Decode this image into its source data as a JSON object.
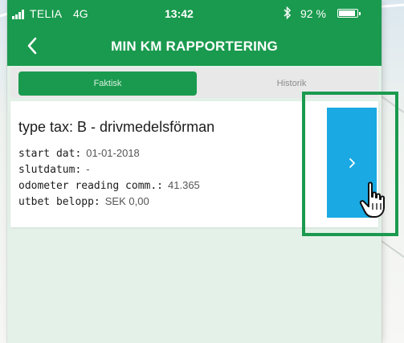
{
  "status_bar": {
    "carrier": "TELIA",
    "network": "4G",
    "time": "13:42",
    "bluetooth_icon": "bluetooth-icon",
    "battery_percent": "92 %",
    "battery_level": 0.92
  },
  "nav": {
    "title": "MIN KM RAPPORTERING",
    "back_icon": "chevron-left-icon"
  },
  "tabs": [
    {
      "label": "Faktisk",
      "active": true
    },
    {
      "label": "Historik",
      "active": false
    }
  ],
  "card": {
    "title": "type tax: B - drivmedelsförman",
    "fields": [
      {
        "label": "start dat:",
        "value": "01-01-2018"
      },
      {
        "label": "slutdatum:",
        "value": "-"
      },
      {
        "label": "odometer reading comm.:",
        "value": "41.365"
      },
      {
        "label": "utbet belopp:",
        "value": "SEK 0,00"
      }
    ],
    "detail_button_icon": "chevron-right-icon"
  },
  "colors": {
    "brand_green": "#1a9a4e",
    "accent_blue": "#1aa9e3",
    "page_background": "#e3f1e8"
  }
}
